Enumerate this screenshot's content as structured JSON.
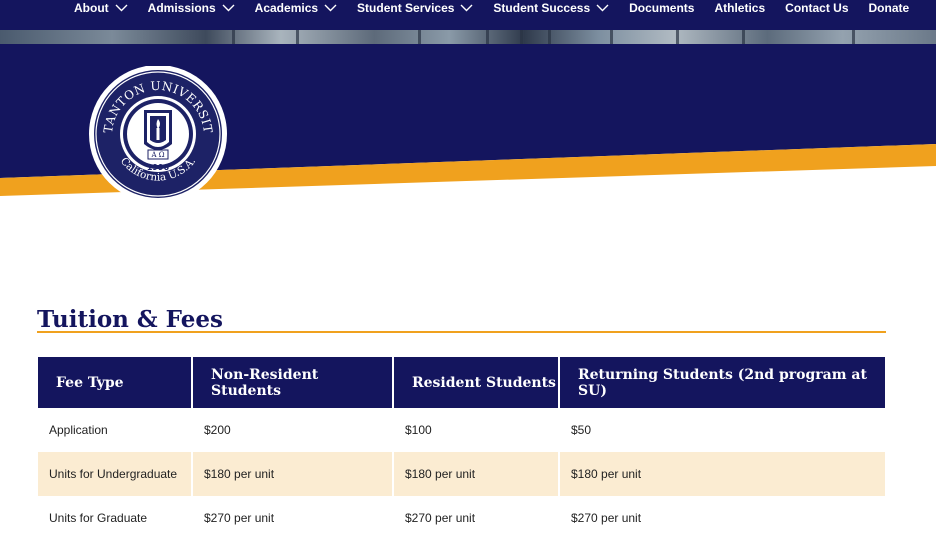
{
  "nav": {
    "items": [
      {
        "label": "About",
        "dropdown": true
      },
      {
        "label": "Admissions",
        "dropdown": true
      },
      {
        "label": "Academics",
        "dropdown": true
      },
      {
        "label": "Student Services",
        "dropdown": true
      },
      {
        "label": "Student Success",
        "dropdown": true
      },
      {
        "label": "Documents",
        "dropdown": false
      },
      {
        "label": "Athletics",
        "dropdown": false
      },
      {
        "label": "Contact Us",
        "dropdown": false
      },
      {
        "label": "Donate",
        "dropdown": false
      }
    ]
  },
  "seal": {
    "top_text": "STANTON UNIVERSITY",
    "bottom_text": "California U.S.A.",
    "year": "1996",
    "greek": "A Ω"
  },
  "page": {
    "title": "Tuition & Fees"
  },
  "table": {
    "headers": [
      "Fee Type",
      "Non-Resident Students",
      "Resident Students",
      "Returning Students (2nd program at SU)"
    ],
    "rows": [
      [
        "Application",
        "$200",
        "$100",
        "$50"
      ],
      [
        "Units for Undergraduate",
        "$180 per unit",
        "$180 per unit",
        "$180 per unit"
      ],
      [
        "Units for Graduate",
        "$270 per unit",
        "$270 per unit",
        "$270 per unit"
      ]
    ]
  },
  "colors": {
    "navy": "#14155e",
    "gold": "#f0a11e",
    "row_alt": "#fbecd2"
  }
}
